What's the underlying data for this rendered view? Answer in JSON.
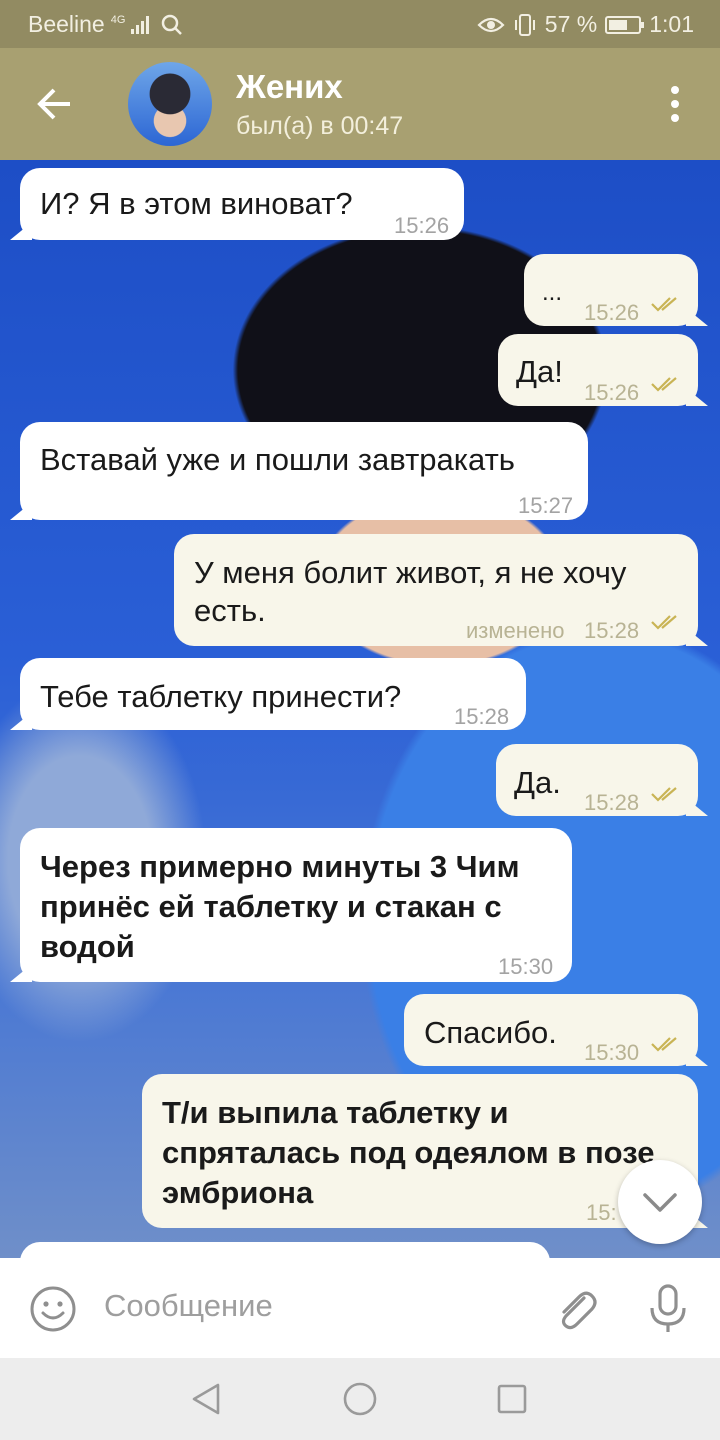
{
  "status_bar": {
    "carrier": "Beeline",
    "network": "4G",
    "battery": "57 %",
    "time": "1:01"
  },
  "header": {
    "title": "Жених",
    "subtitle": "был(а) в 00:47"
  },
  "messages": [
    {
      "dir": "in",
      "text": "И? Я в этом виноват?",
      "time": "15:26"
    },
    {
      "dir": "out",
      "text": "...",
      "time": "15:26",
      "read": true
    },
    {
      "dir": "out",
      "text": "Да!",
      "time": "15:26",
      "read": true
    },
    {
      "dir": "in",
      "text": "Вставай уже и пошли завтракать",
      "time": "15:27"
    },
    {
      "dir": "out",
      "line1": "У меня болит живот, я не хочу",
      "line2": "есть.",
      "edited": "изменено",
      "time": "15:28",
      "read": true
    },
    {
      "dir": "in",
      "text": "Тебе таблетку принести?",
      "time": "15:28"
    },
    {
      "dir": "out",
      "text": "Да.",
      "time": "15:28",
      "read": true
    },
    {
      "dir": "in",
      "line1": "Через примерно минуты 3 Чим",
      "line2": "принёс ей таблетку и стакан с",
      "line3": "водой",
      "time": "15:30"
    },
    {
      "dir": "out",
      "text": "Спасибо.",
      "time": "15:30",
      "read": true
    },
    {
      "dir": "out",
      "line1": "Т/и выпила таблетку и",
      "line2": "спряталась под одеялом в позе",
      "line3": "эмбриона",
      "time": "15:"
    }
  ],
  "input": {
    "placeholder": "Сообщение"
  },
  "icons": {
    "back": "arrow-left-icon",
    "menu": "more-vert-icon",
    "emoji": "emoji-icon",
    "attach": "paperclip-icon",
    "mic": "microphone-icon",
    "scroll": "chevron-down-icon"
  },
  "colors": {
    "header": "#a8a071",
    "status_bar": "#928b62",
    "outgoing_bubble": "#f8f6ea",
    "incoming_bubble": "#ffffff",
    "read_check": "#c9b455"
  }
}
